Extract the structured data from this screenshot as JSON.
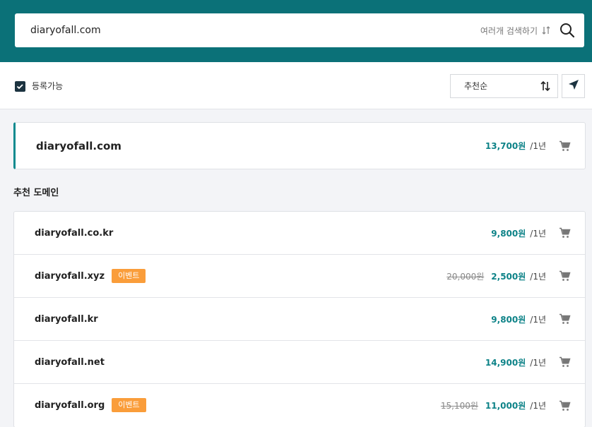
{
  "search": {
    "value": "diaryofall.com",
    "multi_search_label": "여러개 검색하기"
  },
  "filters": {
    "available_label": "등록가능",
    "sort_label": "추천순"
  },
  "main_result": {
    "domain": "diaryofall.com",
    "price": "13,700원",
    "period": "/1년"
  },
  "recommend": {
    "title": "추천 도메인",
    "items": [
      {
        "domain": "diaryofall.co.kr",
        "price": "9,800원",
        "period": "/1년"
      },
      {
        "domain": "diaryofall.xyz",
        "badge": "이벤트",
        "old_price": "20,000원",
        "price": "2,500원",
        "period": "/1년"
      },
      {
        "domain": "diaryofall.kr",
        "price": "9,800원",
        "period": "/1년"
      },
      {
        "domain": "diaryofall.net",
        "price": "14,900원",
        "period": "/1년"
      },
      {
        "domain": "diaryofall.org",
        "badge": "이벤트",
        "old_price": "15,100원",
        "price": "11,000원",
        "period": "/1년"
      }
    ]
  },
  "colors": {
    "header_bg": "#0b7178",
    "price": "#0e8388",
    "badge": "#fa9d3a",
    "checkbox": "#1c3340"
  },
  "icons": [
    "search-icon",
    "sort-toggle-icon",
    "sort-arrows-icon",
    "send-icon",
    "cart-icon",
    "check-icon"
  ]
}
